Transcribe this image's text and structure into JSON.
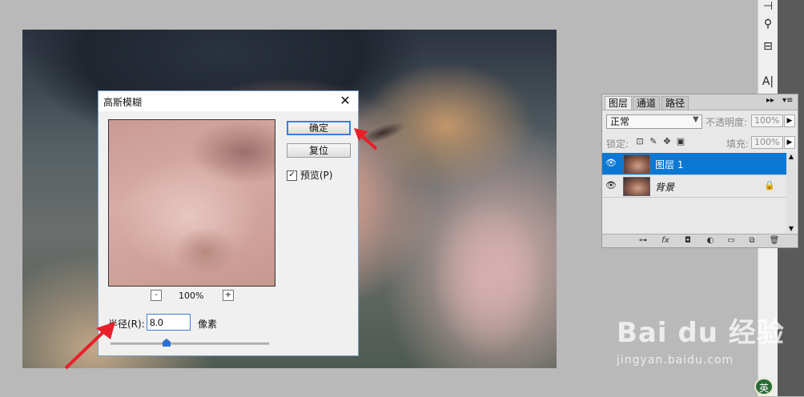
{
  "dialog": {
    "title": "高斯模糊",
    "ok_label": "确定",
    "reset_label": "复位",
    "preview_label": "预览(P)",
    "preview_checked": true,
    "zoom_level": "100%",
    "zoom_out_symbol": "-",
    "zoom_in_symbol": "+",
    "radius_label": "半径(R):",
    "radius_value": "8.0",
    "radius_unit": "像素",
    "close_symbol": "✕"
  },
  "layers_panel": {
    "tabs": [
      "图层",
      "通道",
      "路径"
    ],
    "active_tab": "图层",
    "blend_mode": "正常",
    "opacity_label": "不透明度:",
    "opacity_value": "100%",
    "lock_label": "锁定:",
    "fill_label": "填充:",
    "fill_value": "100%",
    "layers": [
      {
        "name": "图层 1",
        "selected": true,
        "locked": false
      },
      {
        "name": "背景",
        "selected": false,
        "locked": true
      }
    ],
    "collapse_symbol": "▸▸",
    "menu_symbol": "▾≡"
  },
  "watermark": {
    "brand": "Bai du 经验",
    "url": "jingyan.baidu.com"
  },
  "ime_badge": "英",
  "colors": {
    "selection_blue": "#0b78d4",
    "annotation_red": "#e8202a",
    "dialog_border": "#7da2ce"
  },
  "icons": {
    "eye": "eye-icon",
    "lock": "lock-icon",
    "close": "close-icon"
  }
}
